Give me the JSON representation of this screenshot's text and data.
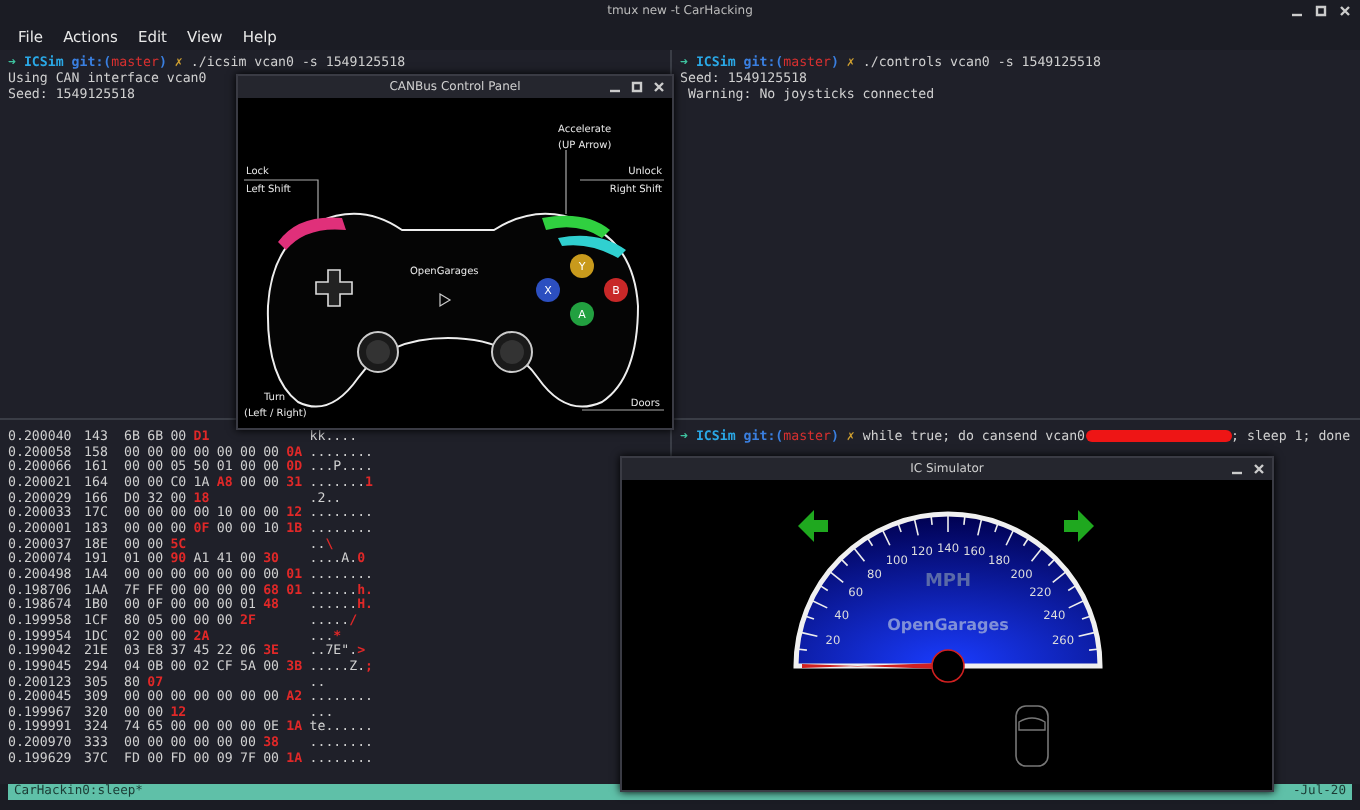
{
  "window": {
    "title": "tmux new -t CarHacking"
  },
  "menu": [
    "File",
    "Actions",
    "Edit",
    "View",
    "Help"
  ],
  "left_pane": {
    "prompt": {
      "arrow": "➜",
      "dir": "ICSim",
      "git": "git:(",
      "branch": "master",
      "git_end": ")",
      "dirty": "✗",
      "command": "./icsim vcan0 -s 1549125518"
    },
    "output": [
      "Using CAN interface vcan0",
      "Seed: 1549125518"
    ]
  },
  "right_pane": {
    "prompt": {
      "arrow": "➜",
      "dir": "ICSim",
      "git": "git:(",
      "branch": "master",
      "git_end": ")",
      "dirty": "✗",
      "command": "./controls vcan0 -s 1549125518"
    },
    "output": [
      "Seed: 1549125518",
      " Warning: No joysticks connected"
    ]
  },
  "candump": {
    "rows": [
      {
        "time": "0.200040",
        "id": "143",
        "bytes": [
          {
            "v": "6B",
            "changed": false
          },
          {
            "v": "6B",
            "changed": false
          },
          {
            "v": "00",
            "changed": false
          },
          {
            "v": "D1",
            "changed": true
          }
        ],
        "ascii": "kk...."
      },
      {
        "time": "0.200058",
        "id": "158",
        "bytes": [
          {
            "v": "00",
            "changed": false
          },
          {
            "v": "00",
            "changed": false
          },
          {
            "v": "00",
            "changed": false
          },
          {
            "v": "00",
            "changed": false
          },
          {
            "v": "00",
            "changed": false
          },
          {
            "v": "00",
            "changed": false
          },
          {
            "v": "00",
            "changed": false
          },
          {
            "v": "0A",
            "changed": true
          }
        ],
        "ascii": "........"
      },
      {
        "time": "0.200066",
        "id": "161",
        "bytes": [
          {
            "v": "00",
            "changed": false
          },
          {
            "v": "00",
            "changed": false
          },
          {
            "v": "05",
            "changed": false
          },
          {
            "v": "50",
            "changed": false
          },
          {
            "v": "01",
            "changed": false
          },
          {
            "v": "00",
            "changed": false
          },
          {
            "v": "00",
            "changed": false
          },
          {
            "v": "0D",
            "changed": true
          }
        ],
        "ascii": "...P...."
      },
      {
        "time": "0.200021",
        "id": "164",
        "bytes": [
          {
            "v": "00",
            "changed": false
          },
          {
            "v": "00",
            "changed": false
          },
          {
            "v": "C0",
            "changed": false
          },
          {
            "v": "1A",
            "changed": false
          },
          {
            "v": "A8",
            "changed": true
          },
          {
            "v": "00",
            "changed": false
          },
          {
            "v": "00",
            "changed": false
          },
          {
            "v": "31",
            "changed": true
          }
        ],
        "ascii": ".......",
        "ascii_changed": "1"
      },
      {
        "time": "0.200029",
        "id": "166",
        "bytes": [
          {
            "v": "D0",
            "changed": false
          },
          {
            "v": "32",
            "changed": false
          },
          {
            "v": "00",
            "changed": false
          },
          {
            "v": "18",
            "changed": true
          }
        ],
        "ascii": ".2.."
      },
      {
        "time": "0.200033",
        "id": "17C",
        "bytes": [
          {
            "v": "00",
            "changed": false
          },
          {
            "v": "00",
            "changed": false
          },
          {
            "v": "00",
            "changed": false
          },
          {
            "v": "00",
            "changed": false
          },
          {
            "v": "10",
            "changed": false
          },
          {
            "v": "00",
            "changed": false
          },
          {
            "v": "00",
            "changed": false
          },
          {
            "v": "12",
            "changed": true
          }
        ],
        "ascii": "........"
      },
      {
        "time": "0.200001",
        "id": "183",
        "bytes": [
          {
            "v": "00",
            "changed": false
          },
          {
            "v": "00",
            "changed": false
          },
          {
            "v": "00",
            "changed": false
          },
          {
            "v": "0F",
            "changed": true
          },
          {
            "v": "00",
            "changed": false
          },
          {
            "v": "00",
            "changed": false
          },
          {
            "v": "10",
            "changed": false
          },
          {
            "v": "1B",
            "changed": true
          }
        ],
        "ascii": "........"
      },
      {
        "time": "0.200037",
        "id": "18E",
        "bytes": [
          {
            "v": "00",
            "changed": false
          },
          {
            "v": "00",
            "changed": false
          },
          {
            "v": "5C",
            "changed": true
          }
        ],
        "ascii": "..",
        "ascii_changed": "\\"
      },
      {
        "time": "0.200074",
        "id": "191",
        "bytes": [
          {
            "v": "01",
            "changed": false
          },
          {
            "v": "00",
            "changed": false
          },
          {
            "v": "90",
            "changed": true
          },
          {
            "v": "A1",
            "changed": false
          },
          {
            "v": "41",
            "changed": false
          },
          {
            "v": "00",
            "changed": false
          },
          {
            "v": "30",
            "changed": true
          }
        ],
        "ascii": "....A.",
        "ascii_changed": "0"
      },
      {
        "time": "0.200498",
        "id": "1A4",
        "bytes": [
          {
            "v": "00",
            "changed": false
          },
          {
            "v": "00",
            "changed": false
          },
          {
            "v": "00",
            "changed": false
          },
          {
            "v": "00",
            "changed": false
          },
          {
            "v": "00",
            "changed": false
          },
          {
            "v": "00",
            "changed": false
          },
          {
            "v": "00",
            "changed": false
          },
          {
            "v": "01",
            "changed": true
          }
        ],
        "ascii": "........"
      },
      {
        "time": "0.198706",
        "id": "1AA",
        "bytes": [
          {
            "v": "7F",
            "changed": false
          },
          {
            "v": "FF",
            "changed": false
          },
          {
            "v": "00",
            "changed": false
          },
          {
            "v": "00",
            "changed": false
          },
          {
            "v": "00",
            "changed": false
          },
          {
            "v": "00",
            "changed": false
          },
          {
            "v": "68",
            "changed": true
          },
          {
            "v": "01",
            "changed": true
          }
        ],
        "ascii": "......",
        "ascii_changed": "h."
      },
      {
        "time": "0.198674",
        "id": "1B0",
        "bytes": [
          {
            "v": "00",
            "changed": false
          },
          {
            "v": "0F",
            "changed": false
          },
          {
            "v": "00",
            "changed": false
          },
          {
            "v": "00",
            "changed": false
          },
          {
            "v": "00",
            "changed": false
          },
          {
            "v": "01",
            "changed": false
          },
          {
            "v": "48",
            "changed": true
          }
        ],
        "ascii": "......",
        "ascii_changed": "H."
      },
      {
        "time": "0.199958",
        "id": "1CF",
        "bytes": [
          {
            "v": "80",
            "changed": false
          },
          {
            "v": "05",
            "changed": false
          },
          {
            "v": "00",
            "changed": false
          },
          {
            "v": "00",
            "changed": false
          },
          {
            "v": "00",
            "changed": false
          },
          {
            "v": "2F",
            "changed": true
          }
        ],
        "ascii": ".....",
        "ascii_changed": "/"
      },
      {
        "time": "0.199954",
        "id": "1DC",
        "bytes": [
          {
            "v": "02",
            "changed": false
          },
          {
            "v": "00",
            "changed": false
          },
          {
            "v": "00",
            "changed": false
          },
          {
            "v": "2A",
            "changed": true
          }
        ],
        "ascii": "...",
        "ascii_changed": "*"
      },
      {
        "time": "0.199042",
        "id": "21E",
        "bytes": [
          {
            "v": "03",
            "changed": false
          },
          {
            "v": "E8",
            "changed": false
          },
          {
            "v": "37",
            "changed": false
          },
          {
            "v": "45",
            "changed": false
          },
          {
            "v": "22",
            "changed": false
          },
          {
            "v": "06",
            "changed": false
          },
          {
            "v": "3E",
            "changed": true
          }
        ],
        "ascii": "..7E\".",
        "ascii_changed": ">"
      },
      {
        "time": "0.199045",
        "id": "294",
        "bytes": [
          {
            "v": "04",
            "changed": false
          },
          {
            "v": "0B",
            "changed": false
          },
          {
            "v": "00",
            "changed": false
          },
          {
            "v": "02",
            "changed": false
          },
          {
            "v": "CF",
            "changed": false
          },
          {
            "v": "5A",
            "changed": false
          },
          {
            "v": "00",
            "changed": false
          },
          {
            "v": "3B",
            "changed": true
          }
        ],
        "ascii": ".....Z.",
        "ascii_changed": ";"
      },
      {
        "time": "0.200123",
        "id": "305",
        "bytes": [
          {
            "v": "80",
            "changed": false
          },
          {
            "v": "07",
            "changed": true
          }
        ],
        "ascii": ".."
      },
      {
        "time": "0.200045",
        "id": "309",
        "bytes": [
          {
            "v": "00",
            "changed": false
          },
          {
            "v": "00",
            "changed": false
          },
          {
            "v": "00",
            "changed": false
          },
          {
            "v": "00",
            "changed": false
          },
          {
            "v": "00",
            "changed": false
          },
          {
            "v": "00",
            "changed": false
          },
          {
            "v": "00",
            "changed": false
          },
          {
            "v": "A2",
            "changed": true
          }
        ],
        "ascii": "........"
      },
      {
        "time": "0.199967",
        "id": "320",
        "bytes": [
          {
            "v": "00",
            "changed": false
          },
          {
            "v": "00",
            "changed": false
          },
          {
            "v": "12",
            "changed": true
          }
        ],
        "ascii": "..."
      },
      {
        "time": "0.199991",
        "id": "324",
        "bytes": [
          {
            "v": "74",
            "changed": false
          },
          {
            "v": "65",
            "changed": false
          },
          {
            "v": "00",
            "changed": false
          },
          {
            "v": "00",
            "changed": false
          },
          {
            "v": "00",
            "changed": false
          },
          {
            "v": "00",
            "changed": false
          },
          {
            "v": "0E",
            "changed": false
          },
          {
            "v": "1A",
            "changed": true
          }
        ],
        "ascii": "te......"
      },
      {
        "time": "0.200970",
        "id": "333",
        "bytes": [
          {
            "v": "00",
            "changed": false
          },
          {
            "v": "00",
            "changed": false
          },
          {
            "v": "00",
            "changed": false
          },
          {
            "v": "00",
            "changed": false
          },
          {
            "v": "00",
            "changed": false
          },
          {
            "v": "00",
            "changed": false
          },
          {
            "v": "38",
            "changed": true
          }
        ],
        "ascii": "........"
      },
      {
        "time": "0.199629",
        "id": "37C",
        "bytes": [
          {
            "v": "FD",
            "changed": false
          },
          {
            "v": "00",
            "changed": false
          },
          {
            "v": "FD",
            "changed": false
          },
          {
            "v": "00",
            "changed": false
          },
          {
            "v": "09",
            "changed": false
          },
          {
            "v": "7F",
            "changed": false
          },
          {
            "v": "00",
            "changed": false
          },
          {
            "v": "1A",
            "changed": true
          }
        ],
        "ascii": "........"
      }
    ]
  },
  "bottom_right_pane": {
    "prompt": {
      "arrow": "➜",
      "dir": "ICSim",
      "git": "git:(",
      "branch": "master",
      "git_end": ")",
      "dirty": "✗",
      "command": "while true; do cansend vcan0"
    },
    "command_end": "; sleep 1; done"
  },
  "status_bar": {
    "session": "CarHackin0:sleep*",
    "date": "-Jul-20"
  },
  "control_panel": {
    "title": "CANBus Control Panel",
    "labels": [
      {
        "kind": "lock",
        "text": "Lock"
      },
      {
        "kind": "lock_key",
        "text": "Left Shift"
      },
      {
        "kind": "accel",
        "text": "Accelerate"
      },
      {
        "kind": "accel_key",
        "text": "(UP Arrow)"
      },
      {
        "kind": "unlock",
        "text": "Unlock"
      },
      {
        "kind": "unlock_key",
        "text": "Right Shift"
      },
      {
        "kind": "turn",
        "text": "Turn"
      },
      {
        "kind": "turn_key",
        "text": "(Left / Right)"
      },
      {
        "kind": "doors",
        "text": "Doors"
      },
      {
        "kind": "brand",
        "text": "OpenGarages"
      }
    ],
    "buttons": [
      {
        "label": "Y",
        "color": "#c89a1c"
      },
      {
        "label": "X",
        "color": "#2c4fc0"
      },
      {
        "label": "B",
        "color": "#c82828"
      },
      {
        "label": "A",
        "color": "#22a040"
      }
    ]
  },
  "ic_simulator": {
    "title": "IC Simulator",
    "gauge": {
      "unit": "MPH",
      "brand": "OpenGarages",
      "ticks": [
        "20",
        "40",
        "60",
        "80",
        "100",
        "120",
        "140",
        "160",
        "180",
        "200",
        "220",
        "240",
        "260"
      ]
    }
  }
}
